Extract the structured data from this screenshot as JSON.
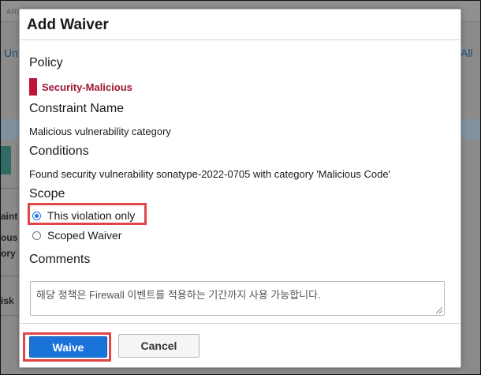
{
  "background": {
    "topbar_text": "ARS",
    "link_left": "Un",
    "link_right": "All",
    "fragments": [
      "aint",
      "ous",
      "ory",
      "isk"
    ]
  },
  "modal": {
    "title": "Add Waiver",
    "policy": {
      "heading": "Policy",
      "name": "Security-Malicious",
      "color": "#c0143a"
    },
    "constraint": {
      "heading": "Constraint Name",
      "value": "Malicious vulnerability category"
    },
    "conditions": {
      "heading": "Conditions",
      "value": "Found security vulnerability sonatype-2022-0705 with category 'Malicious Code'"
    },
    "scope": {
      "heading": "Scope",
      "options": [
        {
          "label": "This violation only",
          "selected": true
        },
        {
          "label": "Scoped Waiver",
          "selected": false
        }
      ]
    },
    "comments": {
      "heading": "Comments",
      "value": "해당 정책은 Firewall 이벤트를 적용하는 기간까지 사용 가능합니다."
    },
    "footer": {
      "waive_label": "Waive",
      "cancel_label": "Cancel"
    }
  },
  "colors": {
    "primary": "#1a73d9",
    "highlight": "#e14548"
  }
}
